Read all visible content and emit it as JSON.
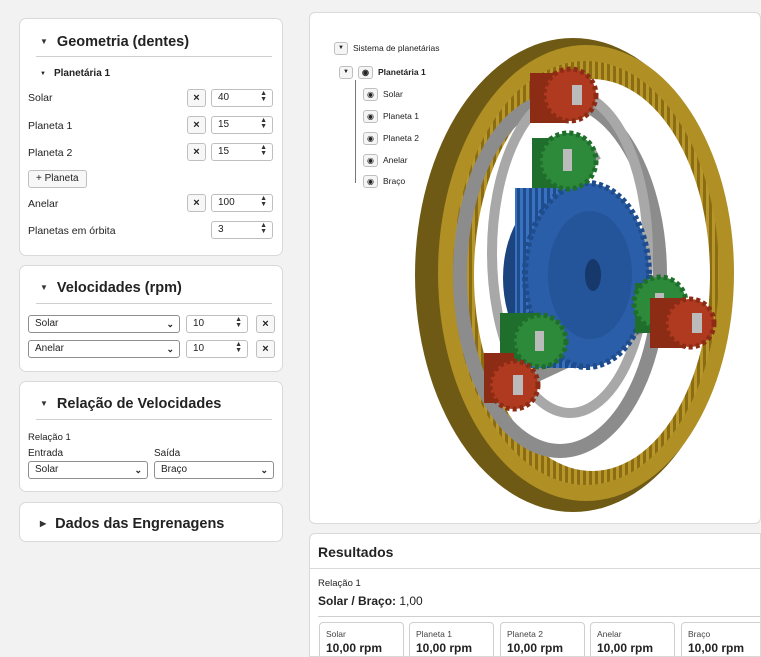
{
  "geometry": {
    "title": "Geometria (dentes)",
    "sub_title": "Planetária 1",
    "rows": [
      {
        "label": "Solar",
        "value": "40"
      },
      {
        "label": "Planeta 1",
        "value": "15"
      },
      {
        "label": "Planeta 2",
        "value": "15"
      },
      {
        "label": "Anelar",
        "value": "100"
      }
    ],
    "add_planet": "+ Planeta",
    "orbit_label": "Planetas em órbita",
    "orbit_value": "3"
  },
  "velocities": {
    "title": "Velocidades (rpm)",
    "rows": [
      {
        "select": "Solar",
        "value": "10"
      },
      {
        "select": "Anelar",
        "value": "10"
      }
    ]
  },
  "ratio": {
    "title": "Relação de Velocidades",
    "relation_label": "Relação 1",
    "input_label": "Entrada",
    "output_label": "Saída",
    "input_value": "Solar",
    "output_value": "Braço"
  },
  "gear_data": {
    "title": "Dados das Engrenagens"
  },
  "tree": {
    "root": "Sistema de planetárias",
    "system": "Planetária 1",
    "children": [
      "Solar",
      "Planeta 1",
      "Planeta 2",
      "Anelar",
      "Braço"
    ]
  },
  "results": {
    "title": "Resultados",
    "relation_label": "Relação 1",
    "ratio_name": "Solar / Braço:",
    "ratio_value": "1,00",
    "cards": [
      {
        "name": "Solar",
        "value": "10,00 rpm"
      },
      {
        "name": "Planeta 1",
        "value": "10,00 rpm"
      },
      {
        "name": "Planeta 2",
        "value": "10,00 rpm"
      },
      {
        "name": "Anelar",
        "value": "10,00 rpm"
      },
      {
        "name": "Braço",
        "value": "10,00 rpm"
      }
    ]
  },
  "colors": {
    "ring": "#a6861c",
    "sun": "#2a5ea8",
    "planet1": "#2d8a3a",
    "planet2": "#b03a1f",
    "arm": "#8f8f8f"
  }
}
